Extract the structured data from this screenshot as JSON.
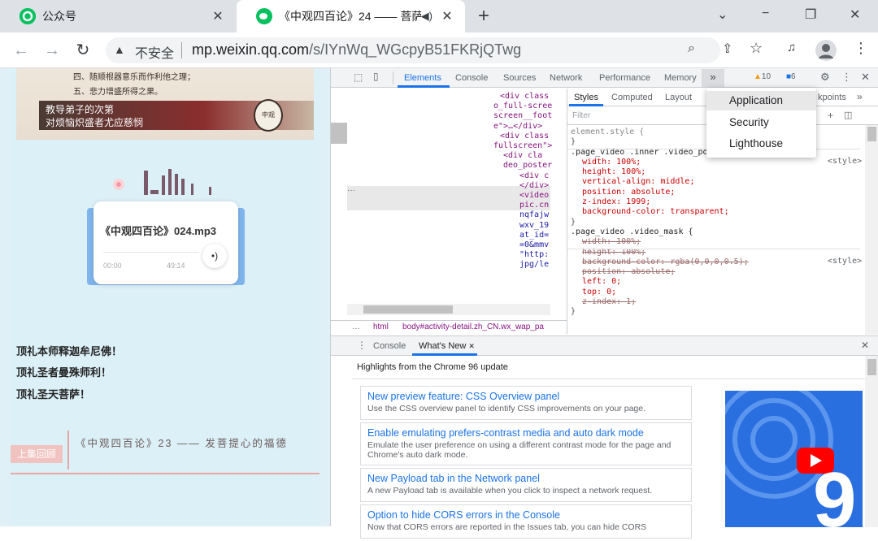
{
  "tabs": [
    {
      "title": "公众号",
      "close": "✕"
    },
    {
      "title": "《中观四百论》24 —— 菩萨和",
      "close": "✕"
    }
  ],
  "new_tab": "+",
  "window": {
    "minimize": "−",
    "restore": "❐",
    "close": "✕",
    "tabsearch": "⌄"
  },
  "toolbar": {
    "back": "←",
    "forward": "→",
    "reload": "↻",
    "insecure": "不安全",
    "url_host": "mp.weixin.qq.com",
    "url_path": "/s/IYnWq_WGcpyB51FKRjQTwg"
  },
  "article": {
    "verse_lines": [
      "四、随顺根器意乐而作利他之理；",
      "五、悲力增盛所得之果。"
    ],
    "caption_lines": [
      "教导弟子的次第",
      "对烦恼炽盛者尤应慈悯"
    ],
    "seal": "中观",
    "audio": {
      "title": "《中观四百论》024.mp3",
      "current": "00:00",
      "duration": "49:14"
    },
    "homage": [
      "顶礼本师释迦牟尼佛！",
      "顶礼圣者曼殊师利！",
      "顶礼圣天菩萨！"
    ],
    "prev_label": "上集回顾",
    "prev_title": "《中观四百论》23 —— 发菩提心的福德"
  },
  "devtools": {
    "tabs": [
      "Elements",
      "Console",
      "Sources",
      "Network",
      "Performance",
      "Memory"
    ],
    "more": "»",
    "warn_count": "10",
    "msg_count": "6",
    "style_tabs": [
      "Styles",
      "Computed",
      "Layout"
    ],
    "style_more": "kpoints",
    "filter_placeholder": "Filter",
    "dropdown": [
      "Application",
      "Security",
      "Lighthouse"
    ],
    "dom_lines": [
      "<div class",
      "o_full-scree",
      "screen__foot",
      "e\">…</div>",
      "<div class",
      "fullscreen\">",
      "<div cla",
      "deo_poster",
      "<div c",
      "</div>",
      "<video",
      "pic.cn",
      "nqfajw",
      "wxv_19",
      "at_id=",
      "=0&mmv",
      "\"http:",
      "jpg/le"
    ],
    "styles": [
      {
        "text": "element.style {",
        "cls": "s"
      },
      {
        "text": "}",
        "cls": "s"
      },
      {
        "text": ".page_video .inner .video_poster .video_mask {",
        "cls": "sel"
      },
      {
        "text": "width: 100%;",
        "cls": "p"
      },
      {
        "text": "height: 100%;",
        "cls": "p"
      },
      {
        "text": "vertical-align: middle;",
        "cls": "p"
      },
      {
        "text": "position: absolute;",
        "cls": "p"
      },
      {
        "text": "z-index: 1999;",
        "cls": "p"
      },
      {
        "text": "background-color: transparent;",
        "cls": "p"
      },
      {
        "text": "}",
        "cls": "s"
      },
      {
        "text": ".page_video .video_mask {",
        "cls": "sel"
      },
      {
        "text": "width: 100%;",
        "cls": "x"
      },
      {
        "text": "height: 100%;",
        "cls": "x"
      },
      {
        "text": "background-color: rgba(0,0,0,0.5);",
        "cls": "x"
      },
      {
        "text": "position: absolute;",
        "cls": "x"
      },
      {
        "text": "left: 0;",
        "cls": "p"
      },
      {
        "text": "top: 0;",
        "cls": "p"
      },
      {
        "text": "z-index: 1;",
        "cls": "x"
      },
      {
        "text": "}",
        "cls": "s"
      }
    ],
    "style_src": "<style>",
    "breadcrumb": [
      "…",
      "html",
      "body#activity-detail.zh_CN.wx_wap_pa"
    ],
    "drawer_tabs": [
      "Console",
      "What's New"
    ],
    "drawer_close": "✕",
    "highlights": "Highlights from the Chrome 96 update",
    "news": [
      {
        "title": "New preview feature: CSS Overview panel",
        "desc": "Use the CSS overview panel to identify CSS improvements on your page."
      },
      {
        "title": "Enable emulating prefers-contrast media and auto dark mode",
        "desc": "Emulate the user preference on using a different contrast mode for the page and Chrome's auto dark mode."
      },
      {
        "title": "New Payload tab in the Network panel",
        "desc": "A new Payload tab is available when you click to inspect a network request."
      },
      {
        "title": "Option to hide CORS errors in the Console",
        "desc": "Now that CORS errors are reported in the Issues tab, you can hide CORS"
      }
    ],
    "promo_digit": "9"
  },
  "colors": {
    "link": "#1a73e8",
    "accent": "#1a73e8",
    "wechat": "#07c160",
    "prev_accent": "#e9a7a4"
  }
}
